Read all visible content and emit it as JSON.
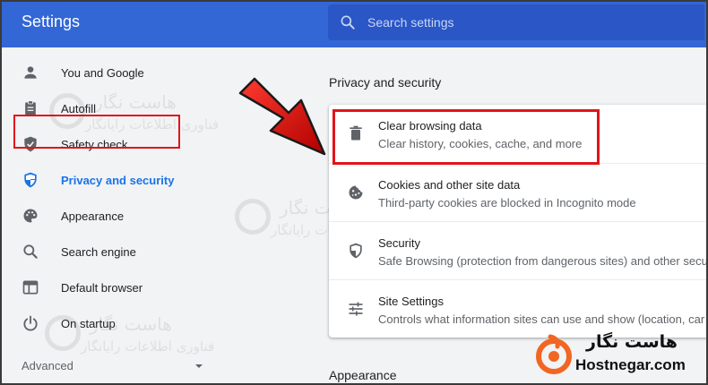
{
  "header": {
    "title": "Settings",
    "search_placeholder": "Search settings",
    "search_value": ""
  },
  "sidebar": {
    "items": [
      {
        "label": "You and Google",
        "icon": "person-icon"
      },
      {
        "label": "Autofill",
        "icon": "clipboard-icon"
      },
      {
        "label": "Safety check",
        "icon": "shield-check-icon"
      },
      {
        "label": "Privacy and security",
        "icon": "shield-icon",
        "active": true
      },
      {
        "label": "Appearance",
        "icon": "palette-icon"
      },
      {
        "label": "Search engine",
        "icon": "search-icon"
      },
      {
        "label": "Default browser",
        "icon": "browser-window-icon"
      },
      {
        "label": "On startup",
        "icon": "power-icon"
      }
    ],
    "advanced_label": "Advanced"
  },
  "main": {
    "section_title": "Privacy and security",
    "rows": [
      {
        "title": "Clear browsing data",
        "subtitle": "Clear history, cookies, cache, and more",
        "icon": "trash-icon"
      },
      {
        "title": "Cookies and other site data",
        "subtitle": "Third-party cookies are blocked in Incognito mode",
        "icon": "cookie-icon"
      },
      {
        "title": "Security",
        "subtitle": "Safe Browsing (protection from dangerous sites) and other secu",
        "icon": "shield-icon"
      },
      {
        "title": "Site Settings",
        "subtitle": "Controls what information sites can use and show (location, car",
        "icon": "sliders-icon"
      }
    ],
    "next_section_title": "Appearance"
  },
  "watermark": {
    "title": "هاست نگار",
    "subtitle": "فناوری اطلاعات رایانگار"
  },
  "brand": {
    "name_fa": "هاست نگار",
    "name_en": "Hostnegar.com"
  },
  "colors": {
    "header": "#3367d6",
    "accent": "#1a73e8",
    "highlight": "#e0141b",
    "brand_orange": "#f26522"
  }
}
